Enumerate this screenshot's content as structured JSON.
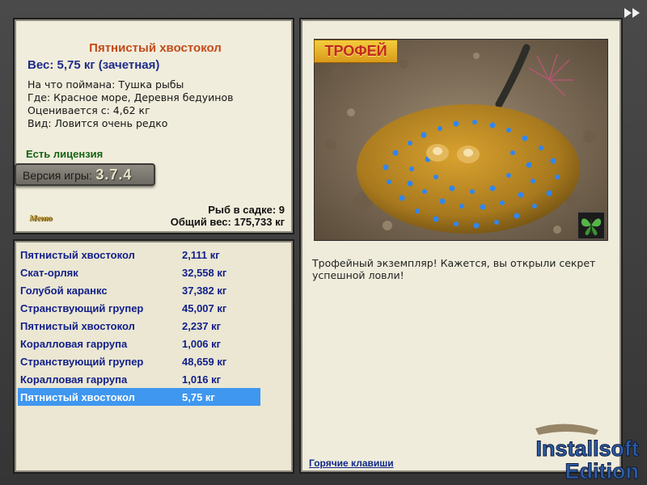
{
  "fish_info": {
    "title": "Пятнистый хвостокол",
    "weight": "Вес: 5,75 кг (зачетная)",
    "caught_on": "На что поймана: Тушка рыбы",
    "location": "Где: Красное море, Деревня бедуинов",
    "valued_from": "Оценивается с: 4,62 кг",
    "kind": "Вид: Ловится очень редко",
    "license": "Есть лицензия",
    "version_label": "Версия игры:",
    "version_number": "3.7.4",
    "menu_logo": "Меню",
    "fish_in_keep": "Рыб в садке: 9",
    "total_weight": "Общий вес: 175,733 кг"
  },
  "catch_list": [
    {
      "name": "Пятнистый хвостокол",
      "weight": "2,111 кг"
    },
    {
      "name": "Скат-орляк",
      "weight": "32,558 кг"
    },
    {
      "name": "Голубой каранкс",
      "weight": "37,382 кг"
    },
    {
      "name": "Странствующий групер",
      "weight": "45,007 кг"
    },
    {
      "name": "Пятнистый хвостокол",
      "weight": "2,237 кг"
    },
    {
      "name": "Коралловая гаррупа",
      "weight": "1,006 кг"
    },
    {
      "name": "Странствующий групер",
      "weight": "48,659 кг"
    },
    {
      "name": "Коралловая гаррупа",
      "weight": "1,016 кг"
    },
    {
      "name": "Пятнистый хвостокол",
      "weight": "5,75 кг",
      "selected": true
    }
  ],
  "detail": {
    "trophy_badge": "ТРОФЕЙ",
    "trophy_text": "Трофейный экземпляр! Кажется, вы открыли секрет успешной ловли!",
    "hotkeys_link": "Горячие клавиши"
  },
  "watermark": {
    "line1": "Installsoft",
    "line2": "Edition"
  },
  "icons": {
    "next": "double-arrow-right-icon",
    "butterfly": "butterfly-icon"
  },
  "colors": {
    "title": "#c24b1a",
    "weight": "#1e2c8a",
    "license": "#146314",
    "list_text": "#13208a",
    "selection": "#3f97f0"
  }
}
